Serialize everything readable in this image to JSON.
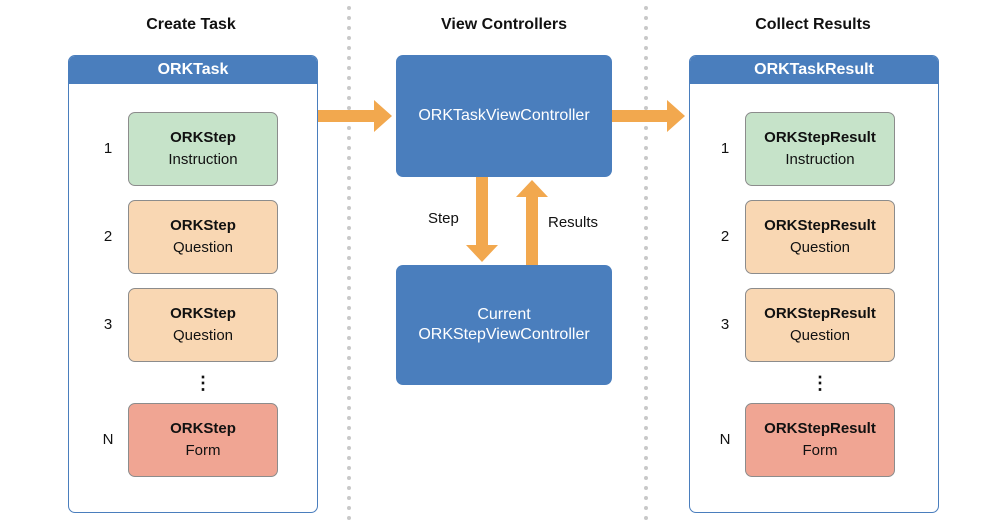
{
  "columns": {
    "left": "Create Task",
    "middle": "View Controllers",
    "right": "Collect Results"
  },
  "task": {
    "title": "ORKTask",
    "items": [
      {
        "number": "1",
        "name": "ORKStep",
        "type": "Instruction",
        "color": "#c6e3c9"
      },
      {
        "number": "2",
        "name": "ORKStep",
        "type": "Question",
        "color": "#f9d7b3"
      },
      {
        "number": "3",
        "name": "ORKStep",
        "type": "Question",
        "color": "#f9d7b3"
      },
      {
        "number": "N",
        "name": "ORKStep",
        "type": "Form",
        "color": "#f0a593"
      }
    ],
    "ellipsis": "⋮"
  },
  "controllers": {
    "task_vc": "ORKTaskViewController",
    "step_vc_line1": "Current",
    "step_vc_line2": "ORKStepViewController",
    "step_label": "Step",
    "results_label": "Results"
  },
  "result": {
    "title": "ORKTaskResult",
    "items": [
      {
        "number": "1",
        "name": "ORKStepResult",
        "type": "Instruction",
        "color": "#c6e3c9"
      },
      {
        "number": "2",
        "name": "ORKStepResult",
        "type": "Question",
        "color": "#f9d7b3"
      },
      {
        "number": "3",
        "name": "ORKStepResult",
        "type": "Question",
        "color": "#f9d7b3"
      },
      {
        "number": "N",
        "name": "ORKStepResult",
        "type": "Form",
        "color": "#f0a593"
      }
    ],
    "ellipsis": "⋮"
  },
  "colors": {
    "blue": "#4a7ebd",
    "arrow": "#f2a84e",
    "separator": "#c8c8c8"
  }
}
